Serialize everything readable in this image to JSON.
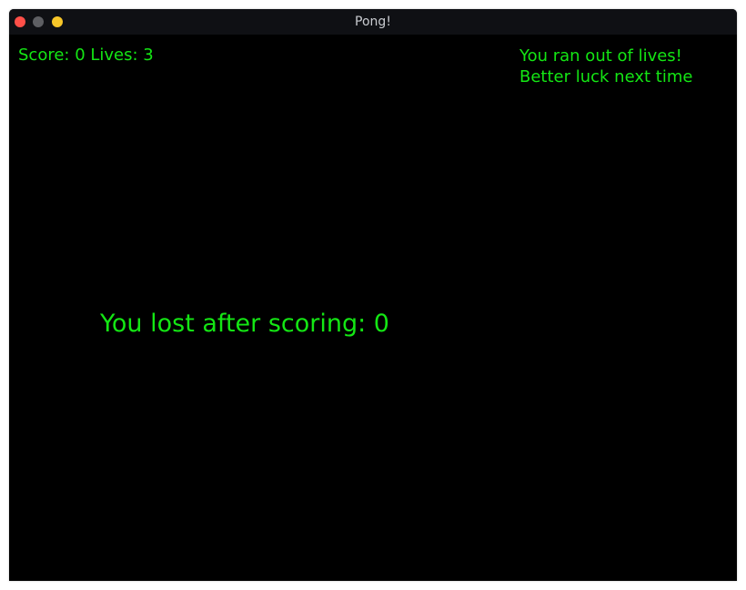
{
  "window": {
    "title": "Pong!"
  },
  "hud": {
    "score_lives": "Score: 0 Lives: 3"
  },
  "messages": {
    "out_of_lives": "You ran out of lives!",
    "better_luck": "Better luck next time",
    "final_score": "You lost after scoring: 0"
  },
  "colors": {
    "text": "#14e614",
    "background": "#000000",
    "titlebar": "#0f1014",
    "close": "#ff4f48",
    "minimize": "#5e5f63",
    "zoom": "#f7c629"
  }
}
